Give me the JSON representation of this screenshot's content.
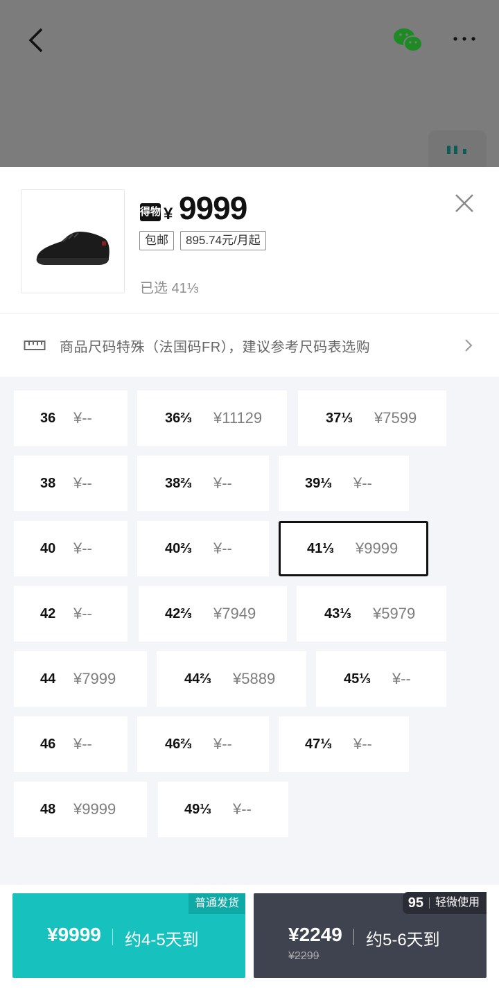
{
  "product": {
    "brand_logo": "得物",
    "currency": "¥",
    "price": "9999",
    "tags": [
      "包邮",
      "895.74元/月起"
    ],
    "selected": "已选 41⅓"
  },
  "notice": {
    "icon": "ruler-icon",
    "text": "商品尺码特殊（法国码FR），建议参考尺码表选购"
  },
  "sizes": [
    {
      "size": "36",
      "price": "¥--"
    },
    {
      "size": "36⅔",
      "price": "¥11129"
    },
    {
      "size": "37⅓",
      "price": "¥7599"
    },
    {
      "size": "38",
      "price": "¥--"
    },
    {
      "size": "38⅔",
      "price": "¥--"
    },
    {
      "size": "39⅓",
      "price": "¥--"
    },
    {
      "size": "40",
      "price": "¥--"
    },
    {
      "size": "40⅔",
      "price": "¥--"
    },
    {
      "size": "41⅓",
      "price": "¥9999"
    },
    {
      "size": "42",
      "price": "¥--"
    },
    {
      "size": "42⅔",
      "price": "¥7949"
    },
    {
      "size": "43⅓",
      "price": "¥5979"
    },
    {
      "size": "44",
      "price": "¥7999"
    },
    {
      "size": "44⅔",
      "price": "¥5889"
    },
    {
      "size": "45⅓",
      "price": "¥--"
    },
    {
      "size": "46",
      "price": "¥--"
    },
    {
      "size": "46⅔",
      "price": "¥--"
    },
    {
      "size": "47⅓",
      "price": "¥--"
    },
    {
      "size": "48",
      "price": "¥9999"
    },
    {
      "size": "49⅓",
      "price": "¥--"
    }
  ],
  "selected_size": "41⅓",
  "buy_normal": {
    "badge": "普通发货",
    "price": "¥9999",
    "arrival": "约4-5天到"
  },
  "buy_used": {
    "badge_grade": "95",
    "badge": "轻微使用",
    "price": "¥2249",
    "original_price": "¥2299",
    "arrival": "约5-6天到"
  },
  "colors": {
    "teal": "#17c2be",
    "dark": "#3f424f",
    "wechat_green": "#1aad19"
  }
}
